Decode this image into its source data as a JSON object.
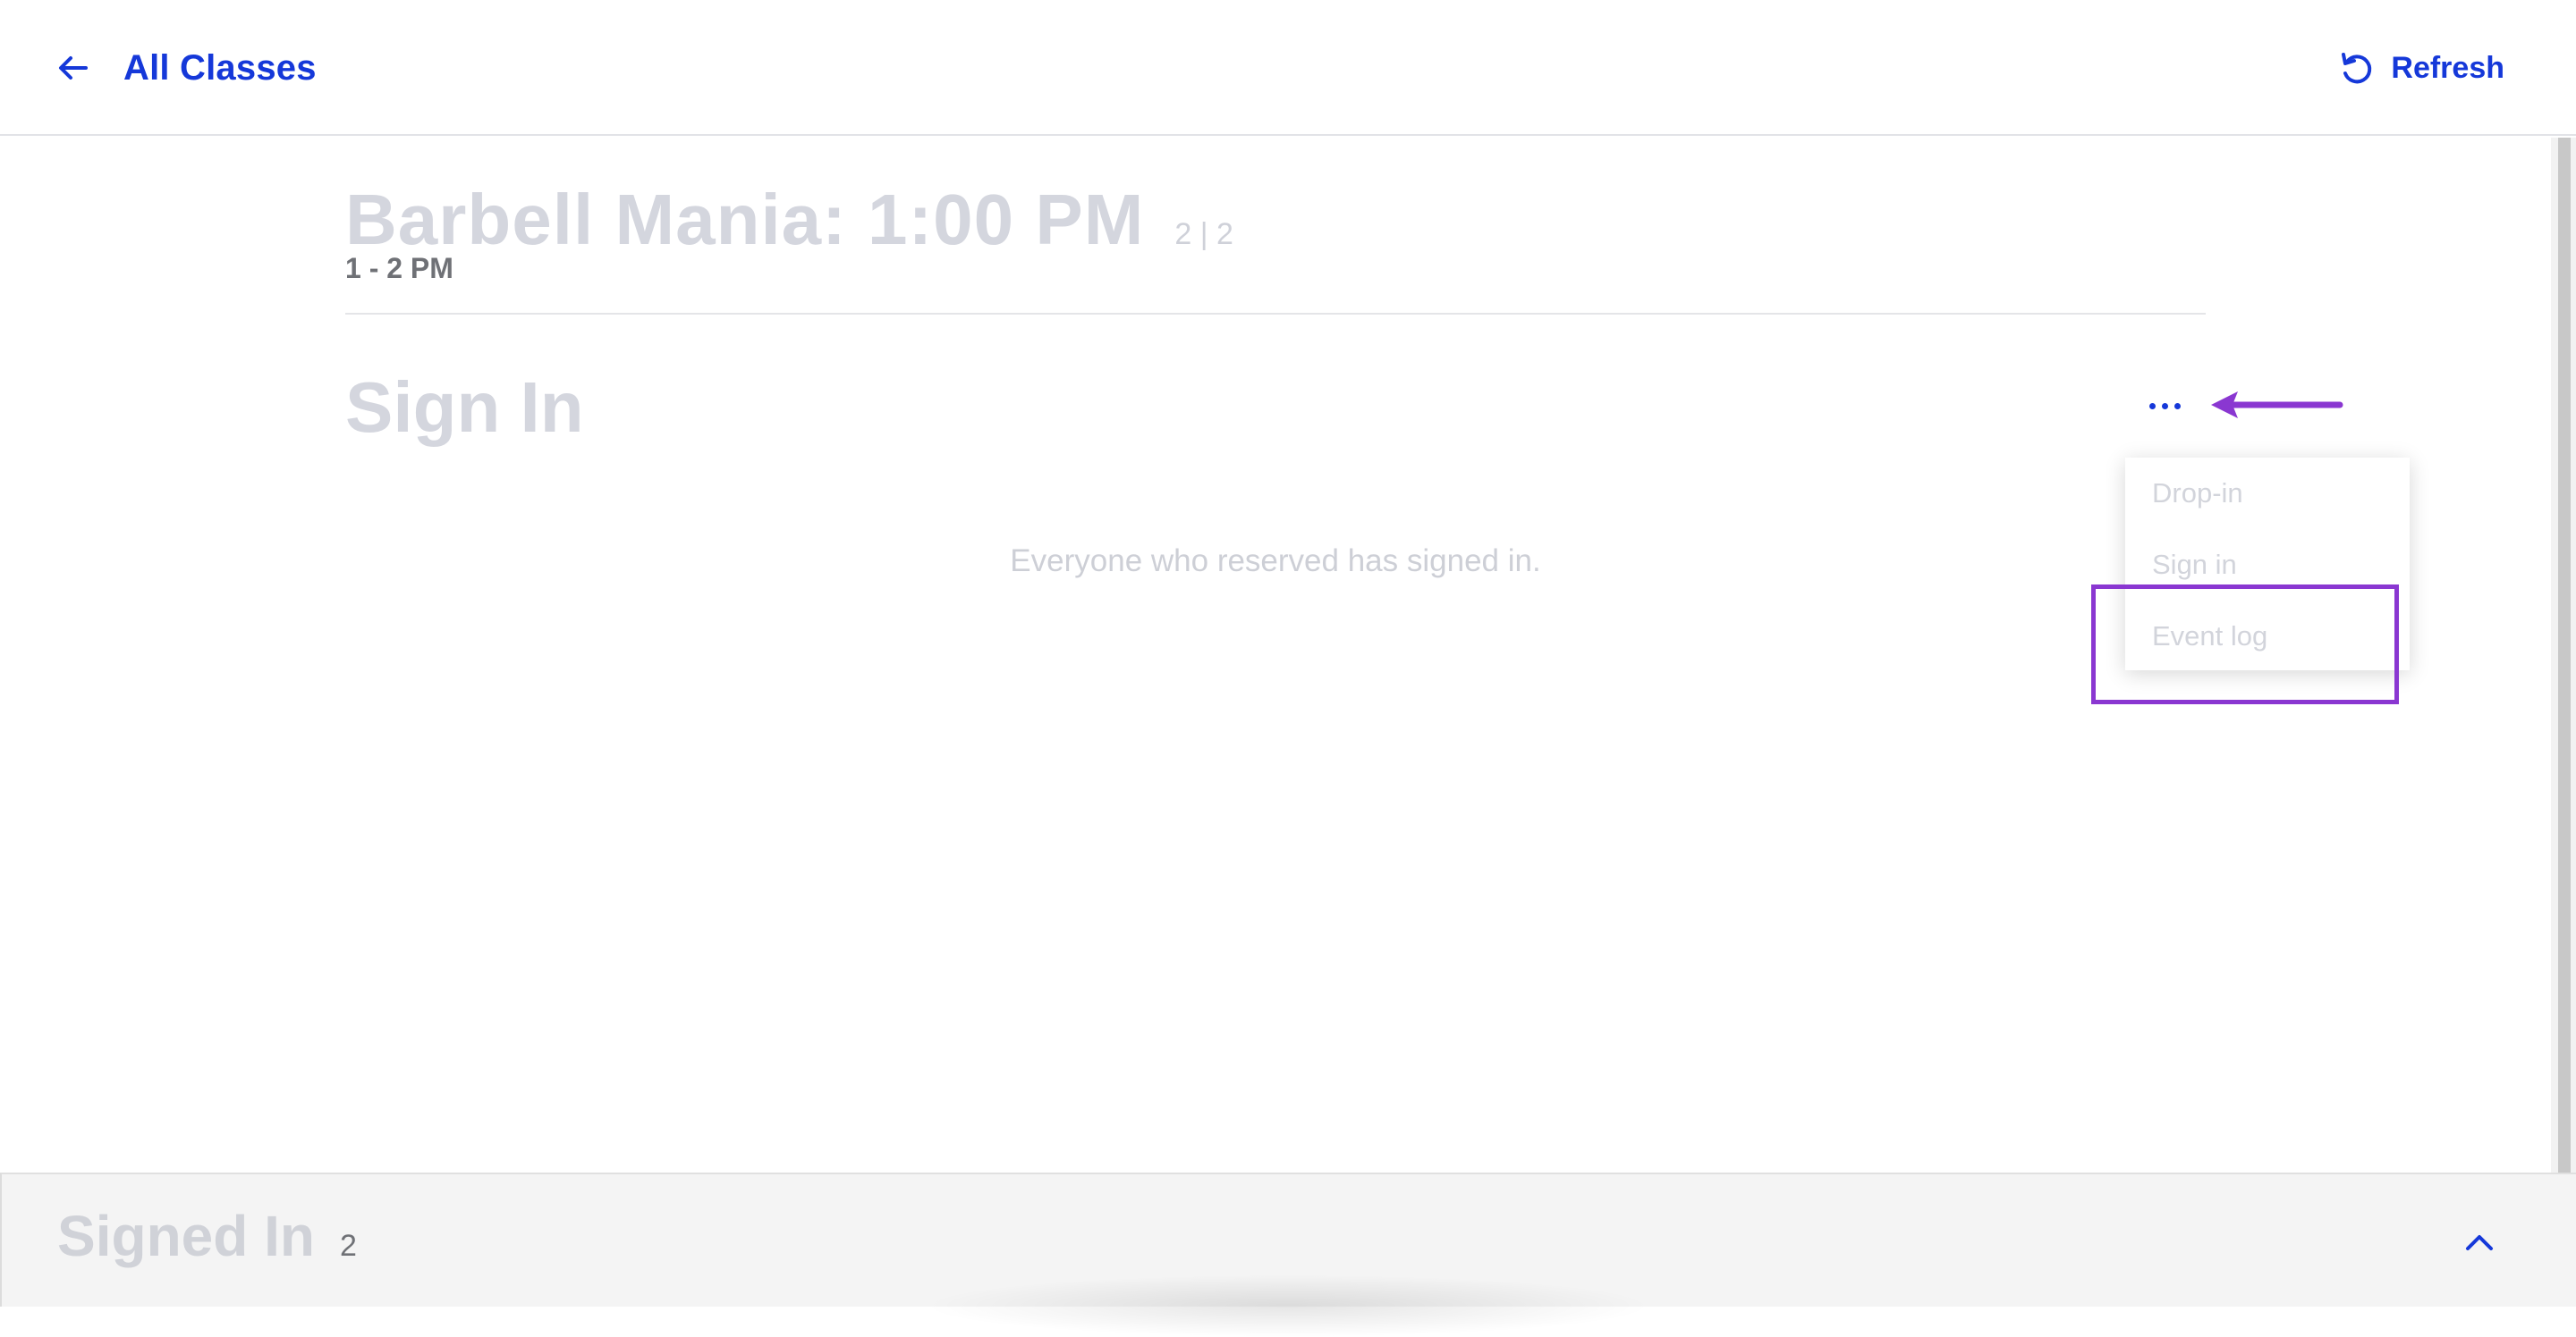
{
  "header": {
    "back_label": "All Classes",
    "refresh_label": "Refresh"
  },
  "class": {
    "title": "Barbell Mania: 1:00 PM",
    "count": "2 | 2",
    "time": "1 - 2 PM"
  },
  "section": {
    "title": "Sign In",
    "empty_message": "Everyone who reserved has signed in."
  },
  "menu": {
    "items": [
      {
        "label": "Drop-in"
      },
      {
        "label": "Sign in"
      },
      {
        "label": "Event log"
      }
    ]
  },
  "signed_in_panel": {
    "title": "Signed In",
    "count": "2"
  },
  "colors": {
    "accent": "#1538d9",
    "annotation": "#8a37d1",
    "muted_text": "#d4d6de"
  },
  "icons": {
    "back": "arrow-left-icon",
    "refresh": "refresh-icon",
    "more": "more-horizontal-icon",
    "expand": "chevron-up-icon"
  }
}
